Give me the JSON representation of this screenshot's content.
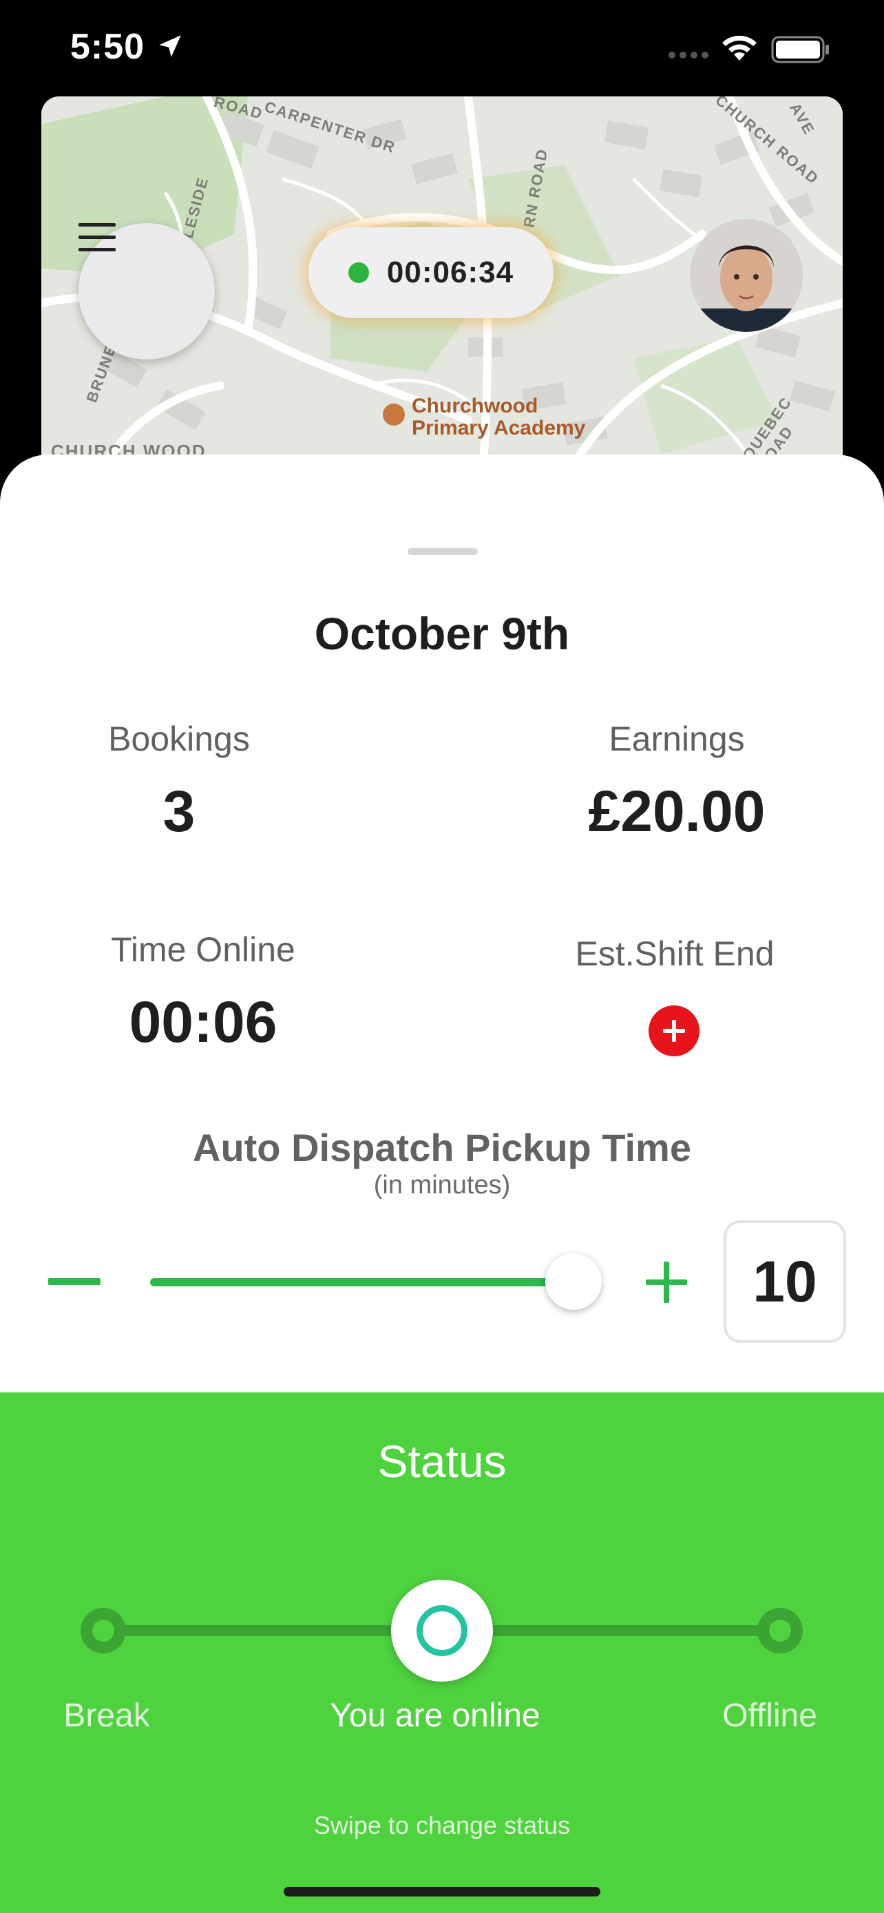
{
  "status_bar": {
    "time": "5:50",
    "icons": [
      "location-arrow-icon",
      "signal-dots-icon",
      "wifi-icon",
      "battery-icon"
    ]
  },
  "map": {
    "timer": "00:06:34",
    "poi_name_line1": "Churchwood",
    "poi_name_line2": "Primary Academy",
    "street_labels": [
      "CARPENTER DR",
      "INGLESIDE",
      "BRUNEL R",
      "CHURCH ROAD",
      "QUEBEC ROAD",
      "CHURCH WOOD",
      "ROAD",
      "AVE",
      "RN ROAD"
    ]
  },
  "summary": {
    "date": "October 9th",
    "bookings_label": "Bookings",
    "bookings_value": "3",
    "earnings_label": "Earnings",
    "earnings_value": "£20.00",
    "time_online_label": "Time Online",
    "time_online_value": "00:06",
    "shift_end_label": "Est.Shift End"
  },
  "auto_dispatch": {
    "title": "Auto Dispatch Pickup Time",
    "subtitle": "(in minutes)",
    "value": "10",
    "slider_fraction": 0.85
  },
  "status": {
    "title": "Status",
    "options": [
      "Break",
      "You are online",
      "Offline"
    ],
    "selected": "You are online",
    "hint": "Swipe to change status"
  },
  "colors": {
    "accent_green": "#4ed23e",
    "slider_green": "#2db84a",
    "add_red": "#e8141b",
    "status_ring": "#22c5a0"
  }
}
